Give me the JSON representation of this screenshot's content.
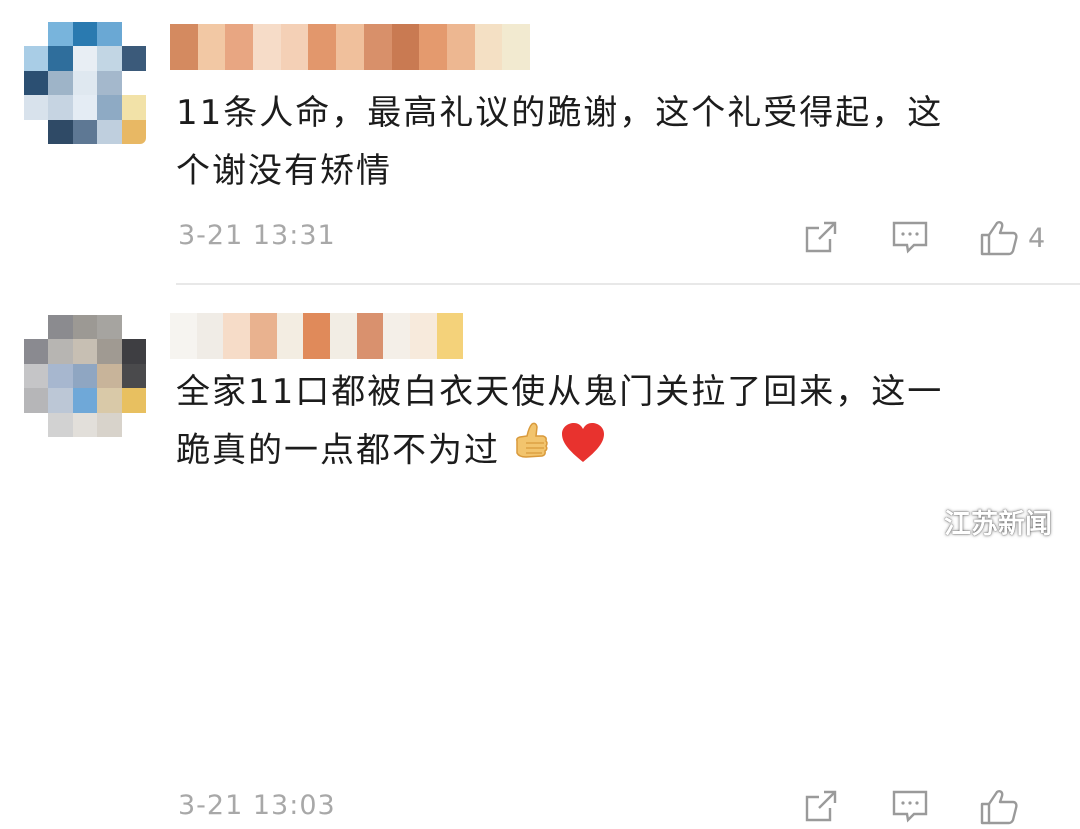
{
  "comments": [
    {
      "text_line1": "11条人命，最高礼议的跪谢，这个礼受得起，这",
      "text_line2": "个谢没有矫情",
      "timestamp": "3-21 13:31",
      "like_count": "4",
      "avatar_colors": [
        "#ffffff",
        "#78b4dc",
        "#2a7ab0",
        "#6aa8d4",
        "#ffffff",
        "#a9cde6",
        "#2f6e9c",
        "#e8eef4",
        "#c2d6e4",
        "#3b5a7a",
        "#2b4f72",
        "#9eb4c8",
        "#dfe8f0",
        "#a4b8cc",
        "#ffffff",
        "#d8e2ec",
        "#c6d4e2",
        "#e4ecf4",
        "#8eaac4",
        "#f2e2a8",
        "#ffffff",
        "#2f4a66",
        "#5e7894",
        "#bfcfde",
        "#e8b864"
      ],
      "username_colors": [
        "#d48a60",
        "#f2c8a4",
        "#e8a682",
        "#f6dcc8",
        "#f4d0b6",
        "#e2976c",
        "#f0c09c",
        "#d8906a",
        "#c97a52",
        "#e49a6e",
        "#edb791",
        "#f4e0c4",
        "#f2ead0"
      ]
    },
    {
      "text_line1": "全家11口都被白衣天使从鬼门关拉了回来，这一",
      "text_line2": "跪真的一点都不为过",
      "timestamp": "3-21 13:03",
      "like_count": "",
      "avatar_colors": [
        "#ffffff",
        "#8b8b8f",
        "#9c9994",
        "#a6a4a0",
        "#ffffff",
        "#8a8a90",
        "#b7b5b2",
        "#c7bfb3",
        "#a09a92",
        "#3e3e42",
        "#c5c5c7",
        "#a7b7cf",
        "#8fa6c2",
        "#c8b49a",
        "#4a4a4c",
        "#b6b6b8",
        "#bcc7d6",
        "#6fa8d8",
        "#d9c9a8",
        "#e8c060",
        "#ffffff",
        "#d2d2d2",
        "#e2dfda",
        "#d8d3cb",
        "#ffffff"
      ],
      "username_colors": [
        "#f6f4f0",
        "#f0ece6",
        "#f6dcc8",
        "#e9b28f",
        "#f3ede2",
        "#e08a5a",
        "#f2ede4",
        "#d9916e",
        "#f4efe8",
        "#f7eadc",
        "#f4d27a",
        "#ffffff"
      ]
    }
  ],
  "watermark": {
    "label": "江苏新闻",
    "icon": "wechat-icon"
  },
  "icons": {
    "share": "share-icon",
    "reply": "reply-icon",
    "like": "thumbs-up-icon"
  },
  "colors": {
    "text": "#1c1c1c",
    "meta": "#a8a8a8",
    "divider": "#e8e8e8",
    "heart": "#e8322e"
  }
}
